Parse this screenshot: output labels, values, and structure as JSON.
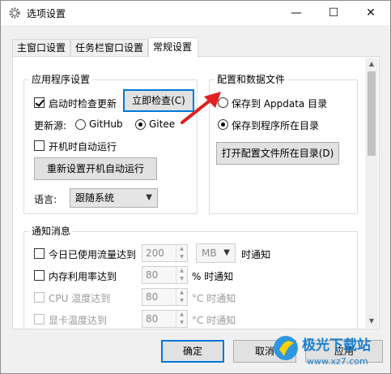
{
  "window": {
    "title": "选项设置",
    "min_glyph": "—",
    "max_glyph": "☐",
    "close_glyph": "✕"
  },
  "tabs": [
    {
      "label": "主窗口设置"
    },
    {
      "label": "任务栏窗口设置"
    },
    {
      "label": "常规设置"
    }
  ],
  "app_settings": {
    "title": "应用程序设置",
    "check_updates_label": "启动时检查更新",
    "check_updates_checked": true,
    "check_now_button": "立即检查(C)",
    "update_source_label": "更新源:",
    "source_github": "GitHub",
    "source_gitee": "Gitee",
    "selected_source": "Gitee",
    "autorun_label": "开机时自动运行",
    "autorun_checked": false,
    "reset_autorun_button": "重新设置开机自动运行",
    "language_label": "语言:",
    "language_value": "跟随系统"
  },
  "config_files": {
    "title": "配置和数据文件",
    "option_appdata": "保存到 Appdata 目录",
    "option_program_dir": "保存到程序所在目录",
    "selected": "保存到程序所在目录",
    "open_dir_button": "打开配置文件所在目录(D)"
  },
  "notifications": {
    "title": "通知消息",
    "traffic": {
      "label": "今日已使用流量达到",
      "value": "200",
      "unit": "MB",
      "suffix": "时通知",
      "enabled": true
    },
    "memory": {
      "label": "内存利用率达到",
      "value": "80",
      "suffix": "% 时通知",
      "enabled": true
    },
    "cpu_temp": {
      "label": "CPU 温度达到",
      "value": "80",
      "suffix": "°C 时通知",
      "enabled": false
    },
    "gpu_temp": {
      "label": "显卡温度达到",
      "value": "80",
      "suffix": "°C 时通知",
      "enabled": false
    }
  },
  "footer": {
    "ok": "确定",
    "cancel": "取消",
    "apply": "应用"
  },
  "watermark": {
    "brand": "极光下载站",
    "url": "www.xz7.com"
  },
  "colors": {
    "accent": "#0078d7",
    "annotation": "#e02020"
  }
}
